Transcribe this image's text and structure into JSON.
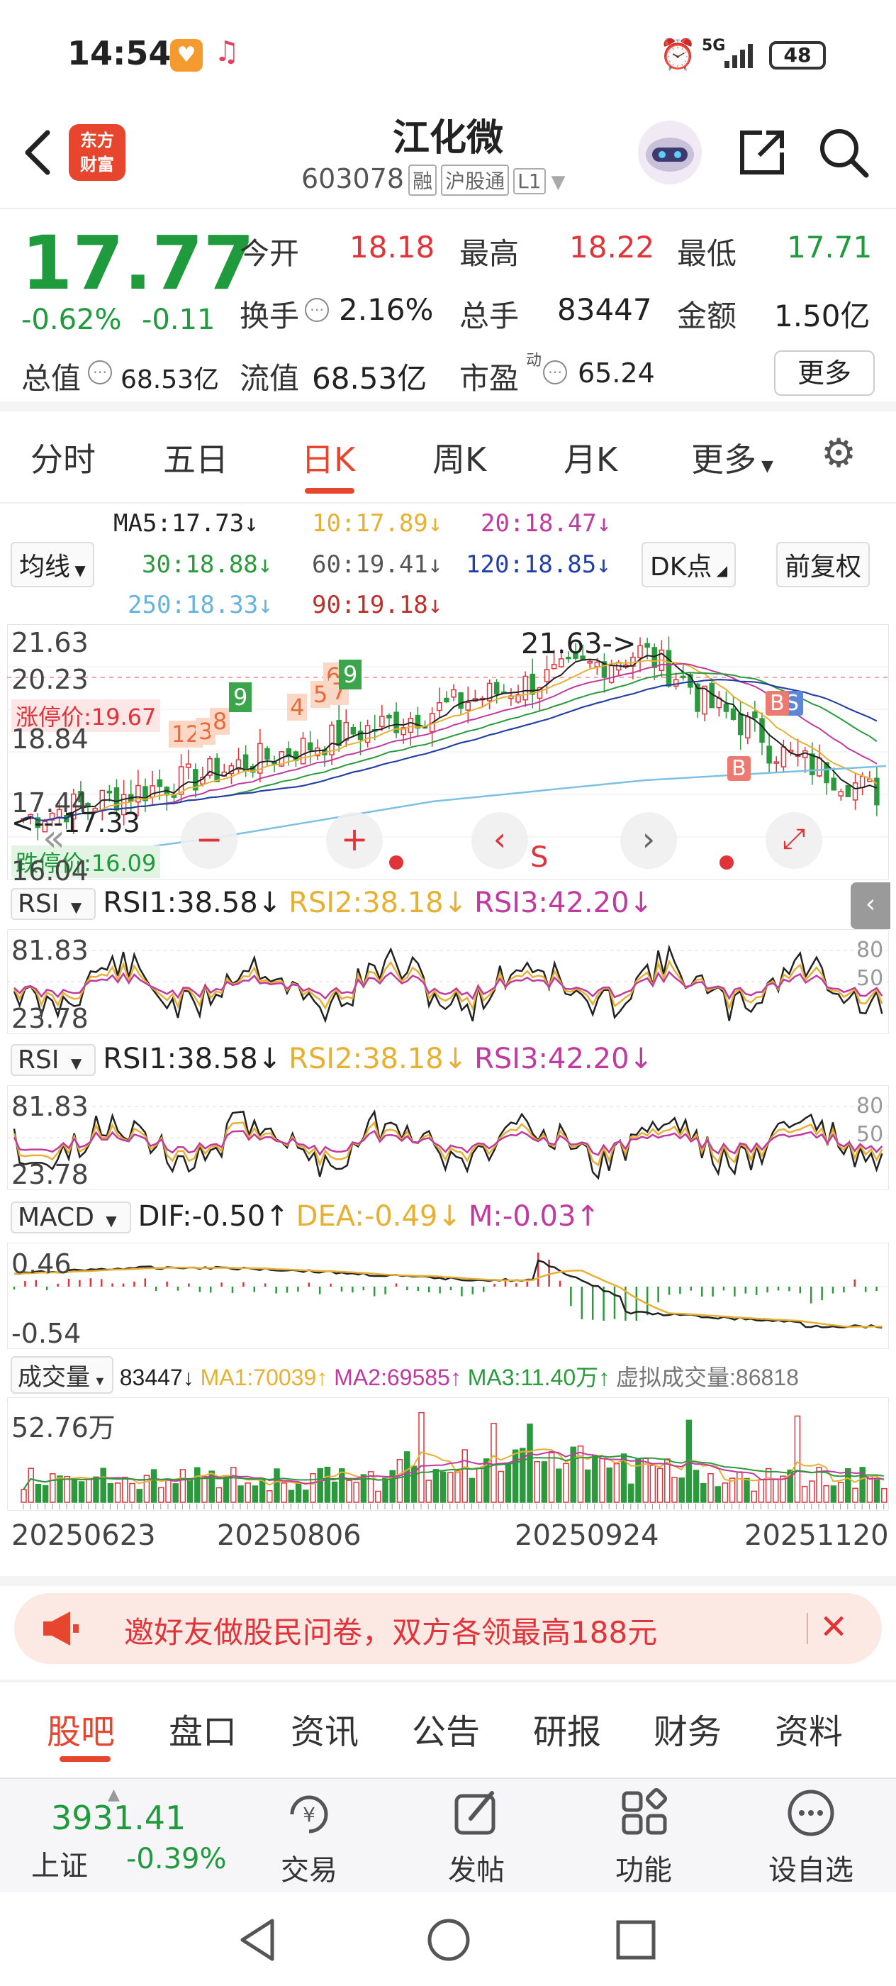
{
  "status": {
    "time": "14:54",
    "battery": "48",
    "network": "5G"
  },
  "header": {
    "app_logo": "东方\n财富",
    "stock_name": "江化微",
    "stock_code": "603078",
    "tags": [
      "融",
      "沪股通",
      "L1"
    ]
  },
  "quote": {
    "price": "17.77",
    "change_pct": "-0.62%",
    "change": "-0.11",
    "open_label": "今开",
    "open": "18.18",
    "high_label": "最高",
    "high": "18.22",
    "low_label": "最低",
    "low": "17.71",
    "turnover_label": "换手",
    "turnover": "2.16%",
    "volume_label": "总手",
    "volume": "83447",
    "amount_label": "金额",
    "amount": "1.50亿",
    "mktcap_label": "总值",
    "mktcap": "68.53亿",
    "float_label": "流值",
    "float": "68.53亿",
    "pe_label": "市盈",
    "pe_sup": "动",
    "pe": "65.24",
    "more": "更多"
  },
  "tabs": [
    "分时",
    "五日",
    "日K",
    "周K",
    "月K",
    "更多"
  ],
  "active_tab": "日K",
  "ma": {
    "ma5": "MA5:17.73↓",
    "ma10": "10:17.89↓",
    "ma20": "20:18.47↓",
    "ma30": "30:18.88↓",
    "ma60": "60:19.41↓",
    "ma120": "120:18.85↓",
    "ma250": "250:18.33↓",
    "ma90": "90:19.18↓",
    "selector": "均线",
    "dk": "DK点",
    "adjust": "前复权"
  },
  "kline": {
    "y_max": "21.63",
    "y2": "20.23",
    "y3": "18.84",
    "y4": "17.44",
    "y_min": "16.04",
    "limit_up": "涨停价:19.67",
    "limit_down": "跌停价:16.09",
    "max_marker": "21.63->",
    "last_marker": "<---17.33",
    "labels": [
      "1",
      "2",
      "3",
      "4",
      "5",
      "6",
      "7",
      "8",
      "9"
    ],
    "markers": {
      "b": "B",
      "s": "S"
    },
    "controls": [
      "«",
      "−",
      "+",
      "‹",
      "S",
      "›",
      "⤢"
    ]
  },
  "rsi": {
    "selector": "RSI",
    "rsi1": "RSI1:38.58↓",
    "rsi2": "RSI2:38.18↓",
    "rsi3": "RSI3:42.20↓",
    "top": "81.83",
    "bottom": "23.78",
    "level80": "80",
    "level50": "50"
  },
  "macd": {
    "selector": "MACD",
    "dif": "DIF:-0.50↑",
    "dea": "DEA:-0.49↓",
    "m": "M:-0.03↑",
    "top": "0.46",
    "bottom": "-0.54"
  },
  "volume": {
    "selector": "成交量",
    "v": "83447↓",
    "ma1": "MA1:70039↑",
    "ma2": "MA2:69585↑",
    "ma3": "MA3:11.40万↑",
    "virtual": "虚拟成交量:86818",
    "top": "52.76万"
  },
  "dates": [
    "20250623",
    "20250806",
    "20250924",
    "20251120"
  ],
  "banner": {
    "text": "邀好友做股民问卷，双方各领最高188元"
  },
  "news_tabs": [
    "股吧",
    "盘口",
    "资讯",
    "公告",
    "研报",
    "财务",
    "资料"
  ],
  "bottom": {
    "index_value": "3931.41",
    "index_name": "上证",
    "index_change": "-0.39%",
    "nav": [
      "交易",
      "发帖",
      "功能",
      "设自选"
    ]
  }
}
